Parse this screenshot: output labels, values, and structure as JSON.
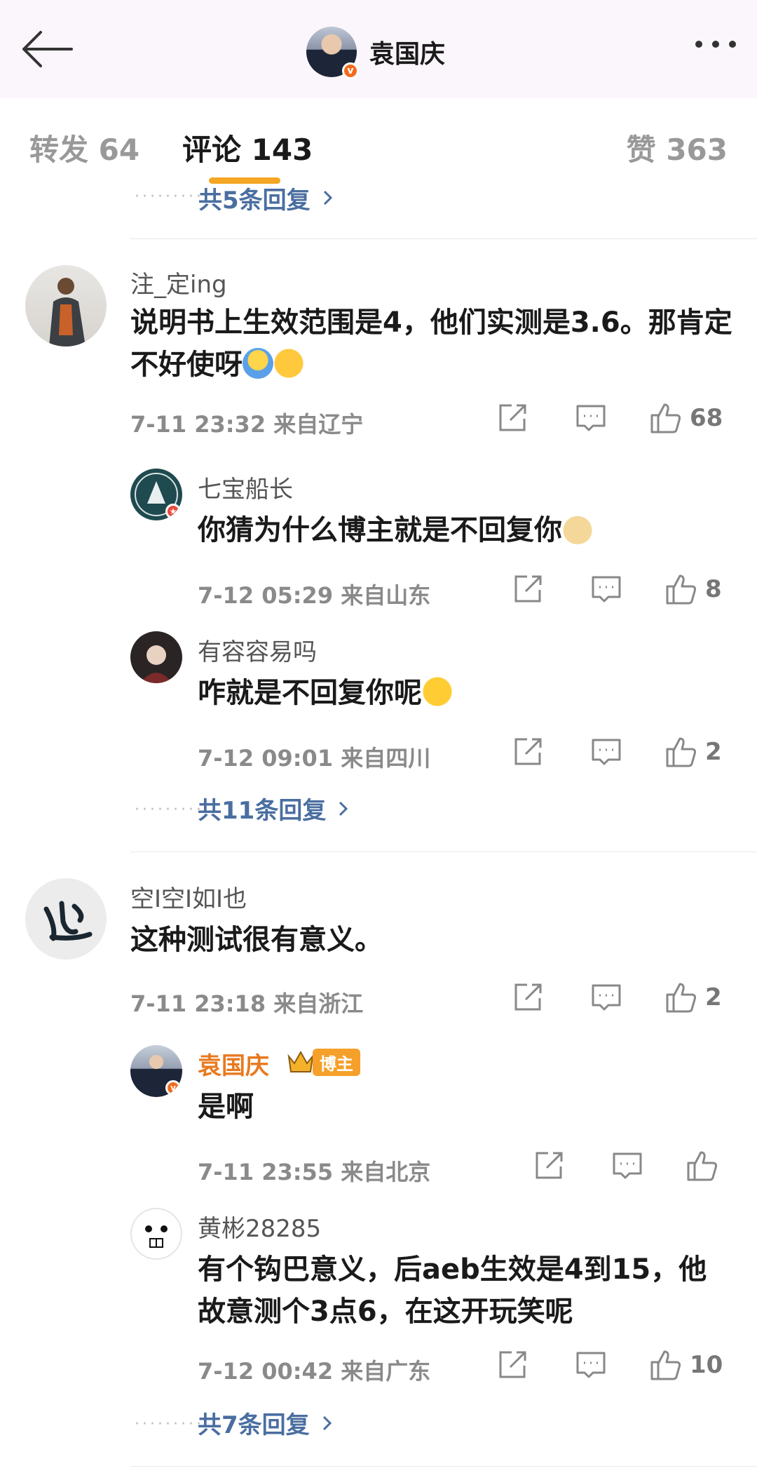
{
  "header": {
    "title": "袁国庆",
    "back_icon": "arrow-left-icon",
    "more_icon": "more-dots-icon"
  },
  "tabs": [
    {
      "label": "转发 64"
    },
    {
      "label": "评论 143"
    },
    {
      "label": "赞 363"
    }
  ],
  "colors": {
    "accent": "#f5a623",
    "link": "#4a6ea0",
    "verified": "#f26b1d"
  },
  "top_partial": {
    "more_replies": "共5条回复"
  },
  "comments": [
    {
      "user": "注_定ing",
      "text": "说明书上生效范围是4，他们实测是3.6。那肯定不好使呀",
      "time": "7-11 23:32  来自辽宁",
      "likes": "68",
      "replies": [
        {
          "user": "七宝船长",
          "text": "你猜为什么博主就是不回复你",
          "time": "7-12 05:29  来自山东",
          "likes": "8"
        },
        {
          "user": "有容容易吗",
          "text": "咋就是不回复你呢",
          "time": "7-12 09:01  来自四川",
          "likes": "2"
        }
      ],
      "more_replies": "共11条回复"
    },
    {
      "user": "空I空I如I也",
      "text": "这种测试很有意义。",
      "time": "7-11 23:18  来自浙江",
      "likes": "2",
      "replies": [
        {
          "user": "袁国庆",
          "badge": "博主",
          "text": "是啊",
          "time": "7-11 23:55  来自北京",
          "likes": ""
        },
        {
          "user": "黄彬28285",
          "text": "有个钩巴意义，后aeb生效是4到15，他故意测个3点6，在这开玩笑呢",
          "time": "7-12 00:42  来自广东",
          "likes": "10"
        }
      ],
      "more_replies": "共7条回复"
    }
  ]
}
